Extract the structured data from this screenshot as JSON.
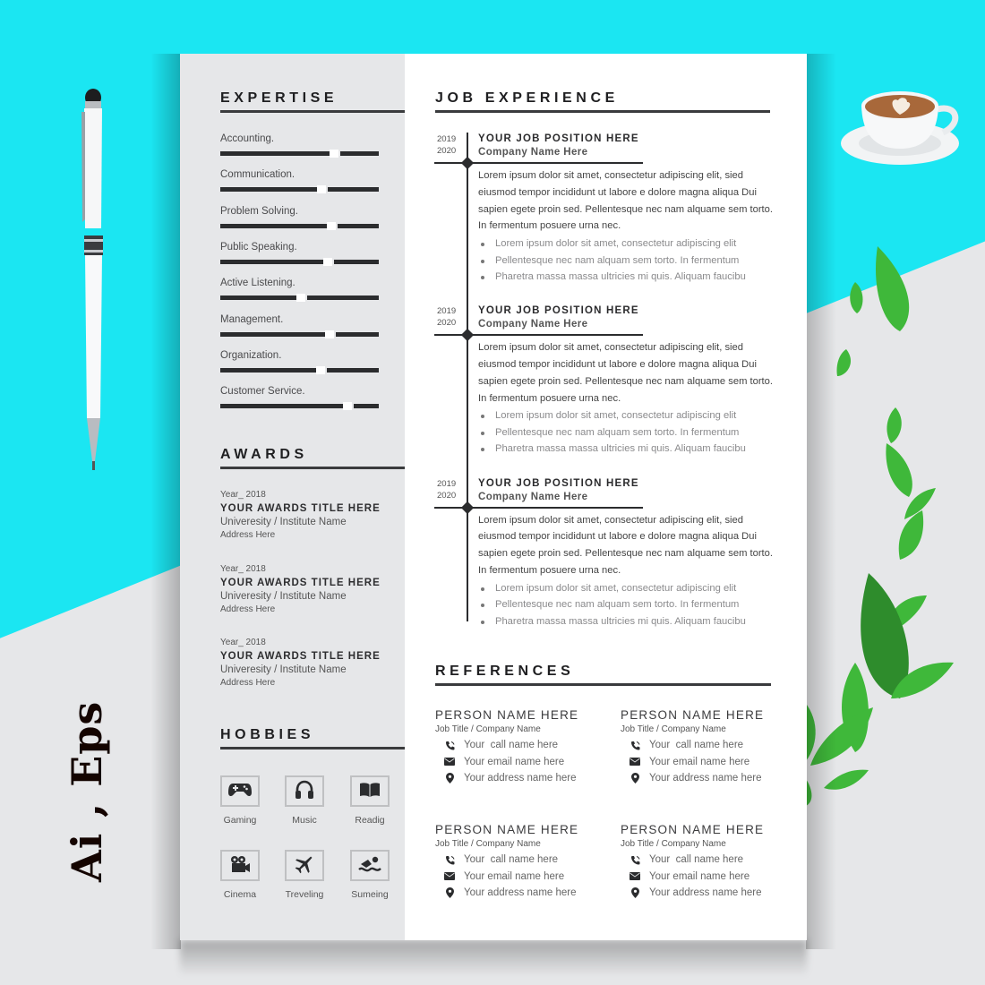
{
  "decor": {
    "format_label": "Ai , Eps",
    "colors": {
      "accent_cyan": "#1be6f2",
      "page_gray": "#e6e7e9",
      "ink": "#2b2c2e"
    }
  },
  "sidebar": {
    "expertise": {
      "title": "EXPERTISE",
      "skills": [
        {
          "label": "Accounting.",
          "level": 0.72
        },
        {
          "label": "Communication.",
          "level": 0.64
        },
        {
          "label": "Problem Solving.",
          "level": 0.7
        },
        {
          "label": "Public Speaking.",
          "level": 0.68
        },
        {
          "label": "Active Listening.",
          "level": 0.51
        },
        {
          "label": "Management.",
          "level": 0.69
        },
        {
          "label": "Organization.",
          "level": 0.63
        },
        {
          "label": "Customer Service.",
          "level": 0.8
        }
      ]
    },
    "awards": {
      "title": "AWARDS",
      "items": [
        {
          "year": "Year_ 2018",
          "title": "YOUR AWARDS TITLE HERE",
          "institute": "Univeresity / Institute Name",
          "address": "Address Here"
        },
        {
          "year": "Year_ 2018",
          "title": "YOUR AWARDS TITLE HERE",
          "institute": "Univeresity / Institute Name",
          "address": "Address Here"
        },
        {
          "year": "Year_ 2018",
          "title": "YOUR AWARDS TITLE HERE",
          "institute": "Univeresity / Institute Name",
          "address": "Address Here"
        }
      ]
    },
    "hobbies": {
      "title": "HOBBIES",
      "items": [
        {
          "label": "Gaming",
          "icon": "gamepad-icon"
        },
        {
          "label": "Music",
          "icon": "headphones-icon"
        },
        {
          "label": "Readig",
          "icon": "book-icon"
        },
        {
          "label": "Cinema",
          "icon": "video-camera-icon"
        },
        {
          "label": "Treveling",
          "icon": "airplane-icon"
        },
        {
          "label": "Sumeing",
          "icon": "swimmer-icon"
        }
      ]
    }
  },
  "main": {
    "experience": {
      "title": "JOB EXPERIENCE",
      "jobs": [
        {
          "start": "2019",
          "end": "2020",
          "position": "YOUR JOB POSITION HERE",
          "company": "Company Name Here",
          "description": "Lorem ipsum dolor sit amet, consectetur adipiscing elit, sied eiusmod tempor incididunt ut labore e dolore magna aliqua Dui sapien egete proin sed. Pellentesque nec nam alquame sem torto. In fermentum posuere urna nec.",
          "bullets": [
            "Lorem ipsum dolor sit amet, consectetur adipiscing elit",
            "Pellentesque nec nam alquam sem torto. In fermentum",
            "Pharetra massa massa ultricies mi quis. Aliquam faucibu"
          ]
        },
        {
          "start": "2019",
          "end": "2020",
          "position": "YOUR JOB POSITION HERE",
          "company": "Company Name Here",
          "description": "Lorem ipsum dolor sit amet, consectetur adipiscing elit, sied eiusmod tempor incididunt ut labore e dolore magna aliqua Dui sapien egete proin sed. Pellentesque nec nam alquame sem torto. In fermentum posuere urna nec.",
          "bullets": [
            "Lorem ipsum dolor sit amet, consectetur adipiscing elit",
            "Pellentesque nec nam alquam sem torto. In fermentum",
            "Pharetra massa massa ultricies mi quis. Aliquam faucibu"
          ]
        },
        {
          "start": "2019",
          "end": "2020",
          "position": "YOUR JOB POSITION HERE",
          "company": "Company Name Here",
          "description": "Lorem ipsum dolor sit amet, consectetur adipiscing elit, sied eiusmod tempor incididunt ut labore e dolore magna aliqua Dui sapien egete proin sed. Pellentesque nec nam alquame sem torto. In fermentum posuere urna nec.",
          "bullets": [
            "Lorem ipsum dolor sit amet, consectetur adipiscing elit",
            "Pellentesque nec nam alquam sem torto. In fermentum",
            "Pharetra massa massa ultricies mi quis. Aliquam faucibu"
          ]
        }
      ]
    },
    "references": {
      "title": "REFERENCES",
      "people": [
        {
          "name": "PERSON NAME HERE",
          "job": "Job Title / Company Name",
          "phone": "Your  call name here",
          "email": "Your email name here",
          "address": "Your address name here"
        },
        {
          "name": "PERSON NAME HERE",
          "job": "Job Title / Company Name",
          "phone": "Your  call name here",
          "email": "Your email name here",
          "address": "Your address name here"
        },
        {
          "name": "PERSON NAME HERE",
          "job": "Job Title / Company Name",
          "phone": "Your  call name here",
          "email": "Your email name here",
          "address": "Your address name here"
        },
        {
          "name": "PERSON NAME HERE",
          "job": "Job Title / Company Name",
          "phone": "Your  call name here",
          "email": "Your email name here",
          "address": "Your address name here"
        }
      ]
    }
  }
}
